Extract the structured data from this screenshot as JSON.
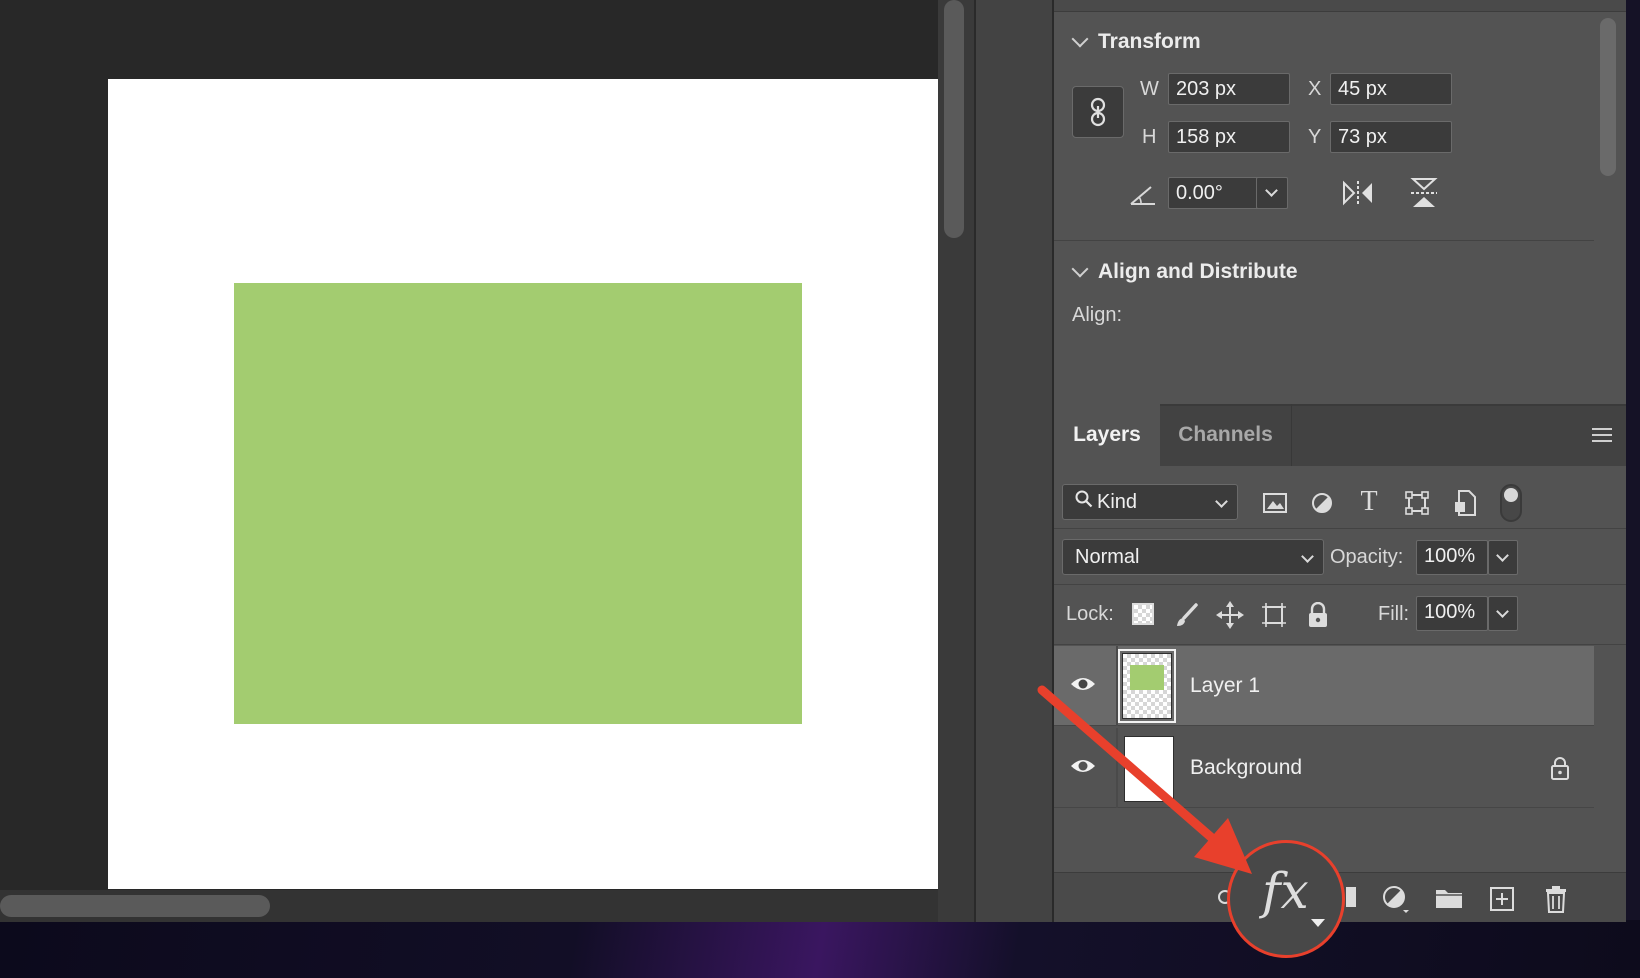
{
  "properties": {
    "transform": {
      "title": "Transform",
      "w_label": "W",
      "w_value": "203 px",
      "h_label": "H",
      "h_value": "158 px",
      "x_label": "X",
      "x_value": "45 px",
      "y_label": "Y",
      "y_value": "73 px",
      "angle_value": "0.00°"
    },
    "align": {
      "title": "Align and Distribute",
      "align_label": "Align:"
    }
  },
  "layers_panel": {
    "tabs": [
      "Layers",
      "Channels"
    ],
    "filter": {
      "kind_label": "Kind"
    },
    "blend_mode": "Normal",
    "opacity_label": "Opacity:",
    "opacity_value": "100%",
    "lock_label": "Lock:",
    "fill_label": "Fill:",
    "fill_value": "100%",
    "layers": [
      {
        "name": "Layer 1",
        "selected": true,
        "visible": true
      },
      {
        "name": "Background",
        "selected": false,
        "visible": true,
        "locked": true
      }
    ]
  },
  "bottom_bar": {
    "fx_label": "fx",
    "icons": [
      "link-layers-icon",
      "add-layer-style-icon",
      "add-mask-icon",
      "adjustment-layer-icon",
      "new-group-icon",
      "new-layer-icon",
      "delete-layer-icon"
    ]
  },
  "colors": {
    "shape_fill": "#a3cc70",
    "annotation": "#e8402c",
    "panel_bg": "#535353"
  }
}
